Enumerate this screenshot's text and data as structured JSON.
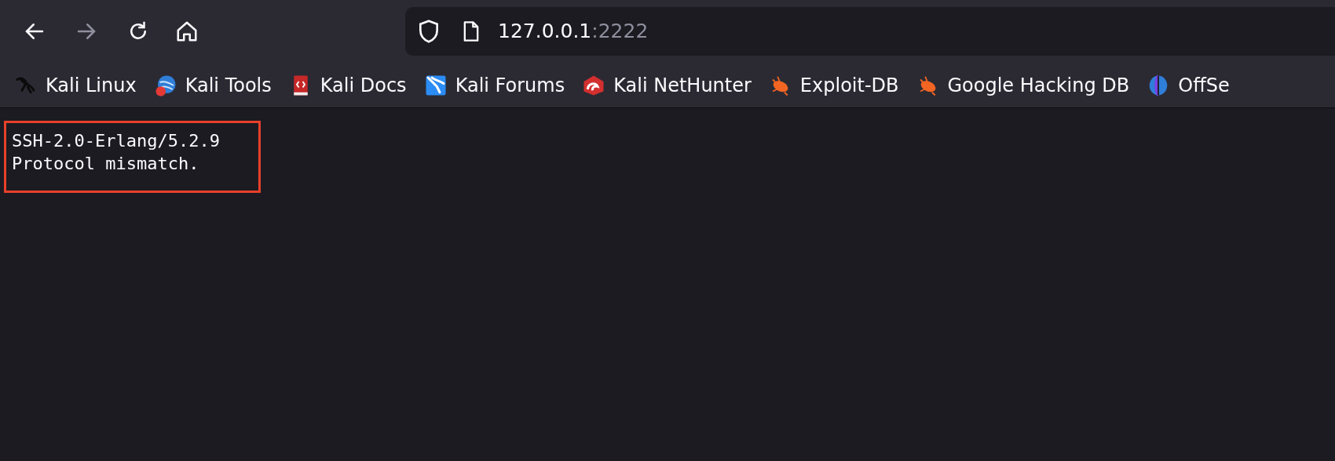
{
  "toolbar": {
    "back_disabled": false,
    "forward_disabled": true,
    "url_host": "127.0.0.1",
    "url_port": ":2222"
  },
  "bookmarks": [
    {
      "label": "Kali Linux"
    },
    {
      "label": "Kali Tools"
    },
    {
      "label": "Kali Docs"
    },
    {
      "label": "Kali Forums"
    },
    {
      "label": "Kali NetHunter"
    },
    {
      "label": "Exploit-DB"
    },
    {
      "label": "Google Hacking DB"
    },
    {
      "label": "OffSe"
    }
  ],
  "content": {
    "lines": [
      "SSH-2.0-Erlang/5.2.9",
      "Protocol mismatch."
    ]
  }
}
